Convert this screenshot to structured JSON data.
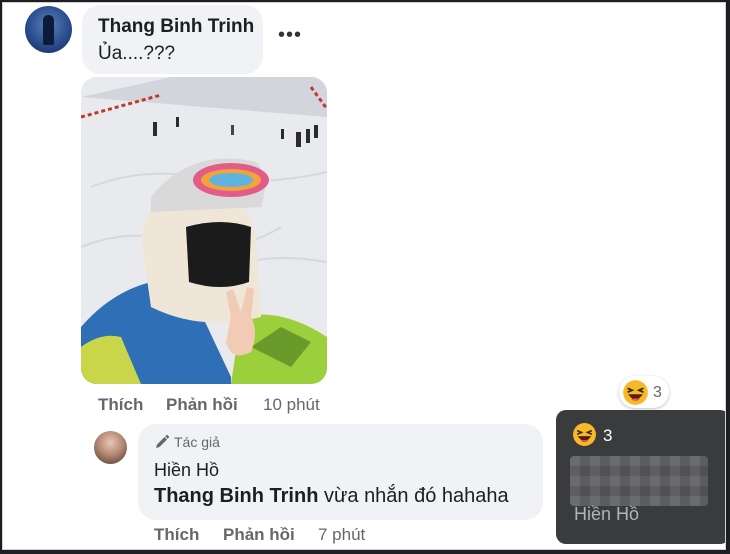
{
  "comment": {
    "author": "Thang Binh Trinh",
    "text": "Ủa....???",
    "more_label": "•••",
    "actions": {
      "like": "Thích",
      "reply": "Phản hồi",
      "time": "10 phút"
    },
    "reaction_count": "3"
  },
  "reply": {
    "author_tag": "Tác giả",
    "author": "Hiền Hồ",
    "mention": "Thang Binh Trinh",
    "text": " vừa nhắn đó hahaha",
    "actions": {
      "like": "Thích",
      "reply": "Phản hồi",
      "time": "7 phút"
    }
  },
  "tooltip": {
    "reaction_count": "3",
    "name": "Hiền Hồ"
  },
  "icons": {
    "reaction": "laughing-emoji-icon",
    "author_tag": "pencil-icon",
    "more": "more-options-icon"
  },
  "colors": {
    "bubble": "#f0f2f5",
    "meta_text": "#65676b",
    "tooltip_bg": "#3a3b3c",
    "emoji_yellow": "#f7b928"
  }
}
